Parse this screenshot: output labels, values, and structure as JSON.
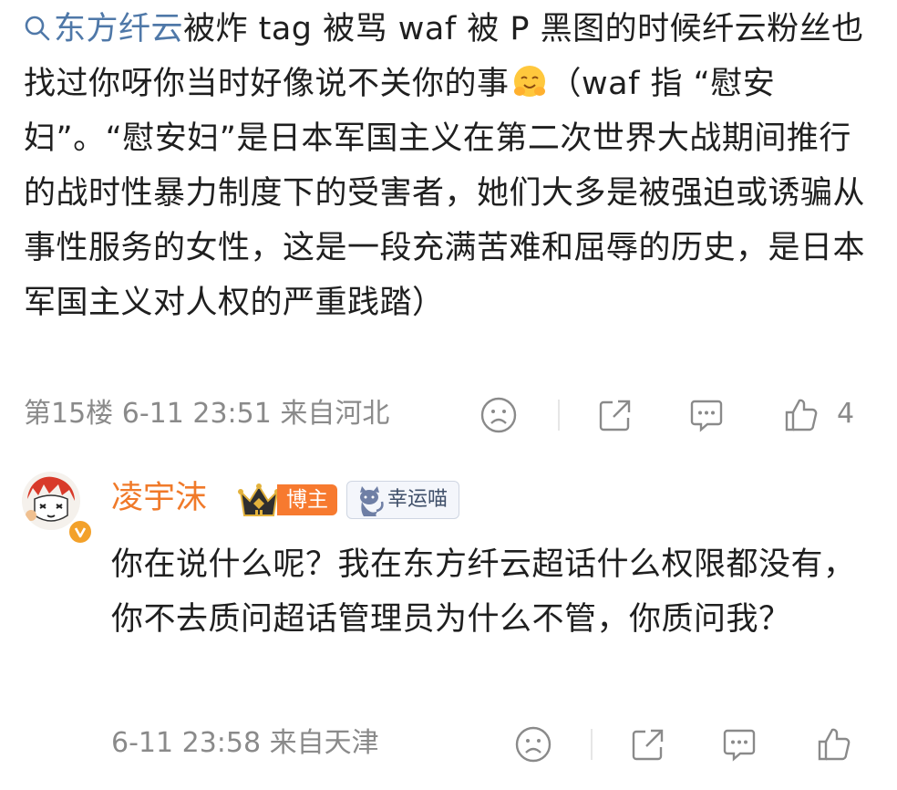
{
  "comment": {
    "topic_link": "东方纤云",
    "text_1": "被炸 tag 被骂 waf 被 P 黑图的时候纤云粉丝也找过你呀你当时好像说不关你的事",
    "text_2": "（waf 指 “慰安妇”。“慰安妇”是日本军国主义在第二次世界大战期间推行的战时性暴力制度下的受害者，她们大多是被强迫或诱骗从事性服务的女性，这是一段充满苦难和屈辱的历史，是日本军国主义对人权的严重践踏）",
    "floor": "第15楼",
    "time": "6-11 23:51",
    "location": "来自河北",
    "like_count": "4"
  },
  "reply": {
    "author": "凌宇沫",
    "role_badge": "博主",
    "fan_badge": "幸运喵",
    "text": "你在说什么呢？我在东方纤云超话什么权限都没有，你不去质问超话管理员为什么不管，你质问我？",
    "time": "6-11 23:58",
    "location": "来自天津"
  },
  "icons": {
    "search": "search-icon",
    "emoji": "hugging-face-emoji",
    "dislike": "frown-face-icon",
    "share": "share-icon",
    "comment": "comment-bubble-icon",
    "like": "thumbs-up-icon"
  },
  "colors": {
    "link": "#4f78a8",
    "author": "#f07a2a",
    "meta": "#8a8a8a"
  }
}
